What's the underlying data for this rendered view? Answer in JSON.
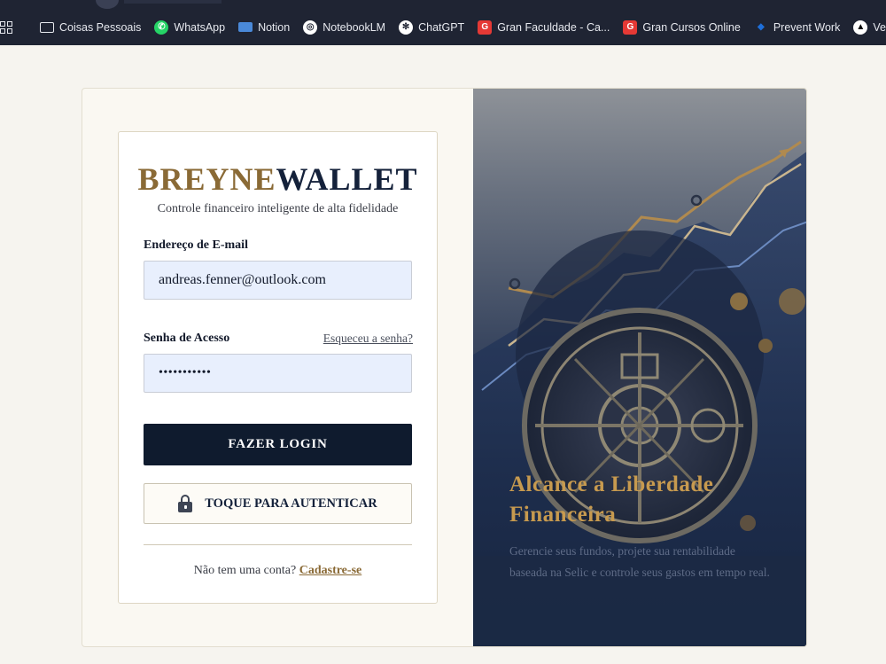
{
  "bookmarks": [
    {
      "label": "Coisas Pessoais",
      "icon": "folder-icon"
    },
    {
      "label": "WhatsApp",
      "icon": "whatsapp-icon"
    },
    {
      "label": "Notion",
      "icon": "notion-icon"
    },
    {
      "label": "NotebookLM",
      "icon": "notebooklm-icon"
    },
    {
      "label": "ChatGPT",
      "icon": "chatgpt-icon"
    },
    {
      "label": "Gran Faculdade - Ca...",
      "icon": "gran-icon"
    },
    {
      "label": "Gran Cursos Online",
      "icon": "gran-icon"
    },
    {
      "label": "Prevent Work",
      "icon": "prevent-icon"
    },
    {
      "label": "Vercel",
      "icon": "vercel-icon"
    }
  ],
  "login": {
    "brand_part1": "BREYNE",
    "brand_part2": "WALLET",
    "tagline": "Controle financeiro inteligente de alta fidelidade",
    "email_label": "Endereço de E-mail",
    "email_value": "andreas.fenner@outlook.com",
    "password_label": "Senha de Acesso",
    "forgot_link": "Esqueceu a senha?",
    "password_value": "•••••••••••",
    "login_button": "FAZER LOGIN",
    "touch_button": "TOQUE PARA AUTENTICAR",
    "signup_prefix": "Não tem uma conta? ",
    "signup_link": "Cadastre-se"
  },
  "hero": {
    "title": "Alcance a Liberdade Financeira",
    "subtitle": "Gerencie seus fundos, projete sua rentabilidade baseada na Selic e controle seus gastos em tempo real."
  },
  "colors": {
    "accent_gold": "#8a6a36",
    "navy": "#0f1b2e",
    "input_bg": "#e8effd"
  }
}
